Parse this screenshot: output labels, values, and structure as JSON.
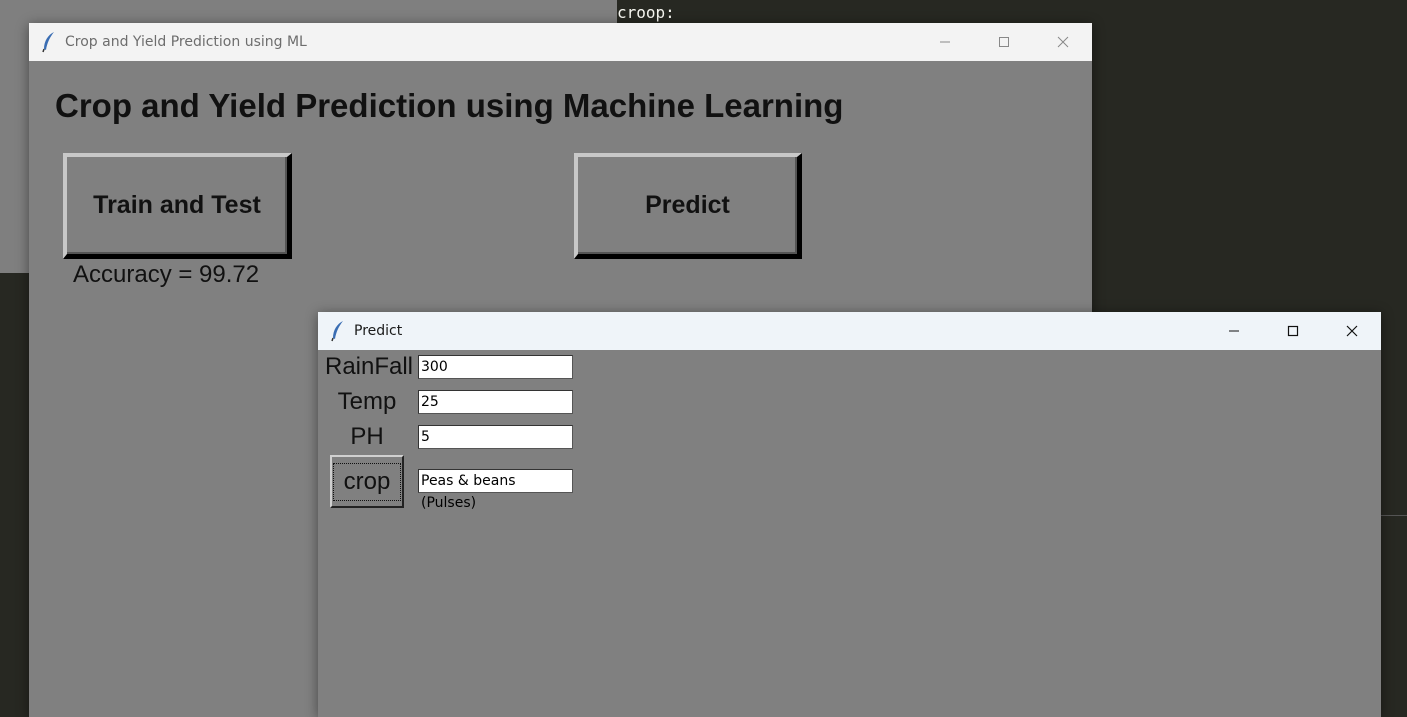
{
  "background_terminal": {
    "text": "croop:"
  },
  "main_window": {
    "title": "Crop and Yield Prediction using ML",
    "heading": "Crop and Yield Prediction using Machine Learning",
    "train_button_label": "Train and Test",
    "predict_button_label": "Predict",
    "accuracy_text": "Accuracy = 99.72"
  },
  "predict_window": {
    "title": "Predict",
    "fields": [
      {
        "label": "RainFall",
        "value": "300"
      },
      {
        "label": "Temp",
        "value": "25"
      },
      {
        "label": "PH",
        "value": "5"
      }
    ],
    "crop_button_label": "crop",
    "crop_result": "Peas & beans (Pulses)"
  },
  "icons": {
    "app_icon": "feather-icon",
    "minimize": "minimize-icon",
    "maximize": "maximize-icon",
    "close": "close-icon"
  },
  "colors": {
    "window_bg": "#808080",
    "terminal_bg": "#272822"
  }
}
